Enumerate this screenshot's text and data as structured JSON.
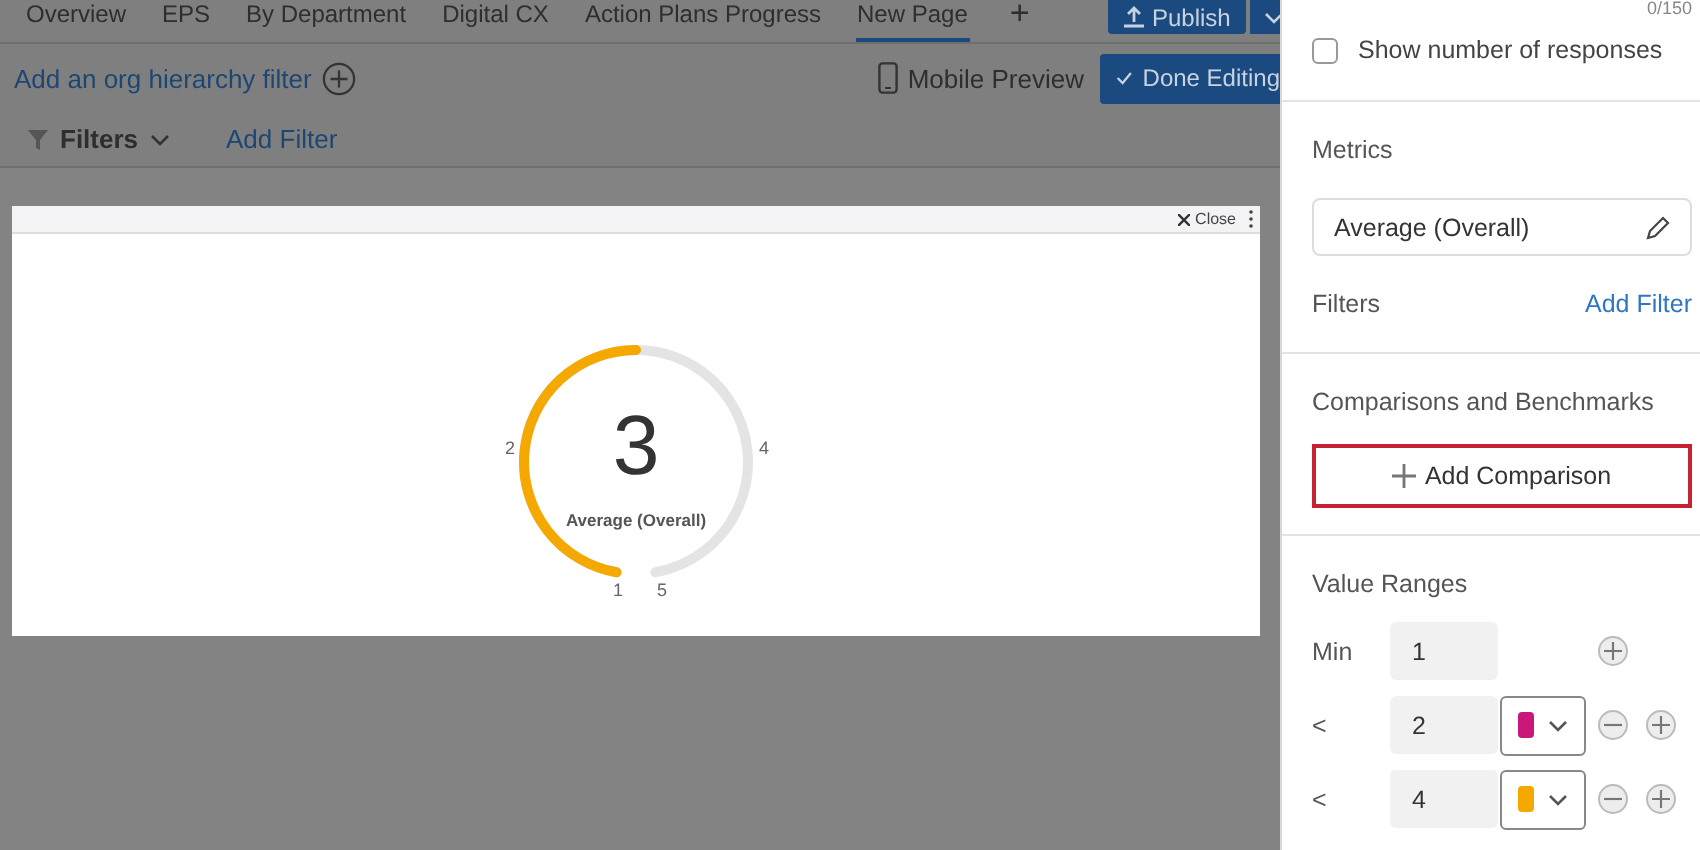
{
  "tabs": [
    {
      "label": "Overview",
      "selected": false
    },
    {
      "label": "EPS",
      "selected": false
    },
    {
      "label": "By Department",
      "selected": false
    },
    {
      "label": "Digital CX",
      "selected": false
    },
    {
      "label": "Action Plans Progress",
      "selected": false
    },
    {
      "label": "New Page",
      "selected": true
    }
  ],
  "add_tab": "+",
  "publish_button": "Publish",
  "org_filter_link": "Add an org hierarchy filter",
  "mobile_preview": "Mobile Preview",
  "done_button": "Done Editing",
  "filter_bar": {
    "label": "Filters",
    "add": "Add Filter"
  },
  "modal": {
    "close": "Close",
    "gauge": {
      "value": "3",
      "label": "Average (Overall)",
      "level": 0.5,
      "ticks": [
        "1",
        "2",
        "4",
        "5"
      ]
    }
  },
  "panel": {
    "counter": "0/150",
    "show_responses": {
      "label": "Show number of responses",
      "checked": false
    },
    "metrics_title": "Metrics",
    "metric": "Average (Overall)",
    "filters_title": "Filters",
    "add_filter": "Add Filter",
    "comparisons_title": "Comparisons and Benchmarks",
    "add_comparison": "Add Comparison",
    "value_ranges_title": "Value Ranges",
    "ranges": [
      {
        "kind": "min",
        "label": "Min",
        "value": "1"
      },
      {
        "kind": "threshold",
        "label": "<",
        "value": "2",
        "color": "#c9187a"
      },
      {
        "kind": "threshold",
        "label": "<",
        "value": "4",
        "color": "#f5a800"
      }
    ]
  }
}
